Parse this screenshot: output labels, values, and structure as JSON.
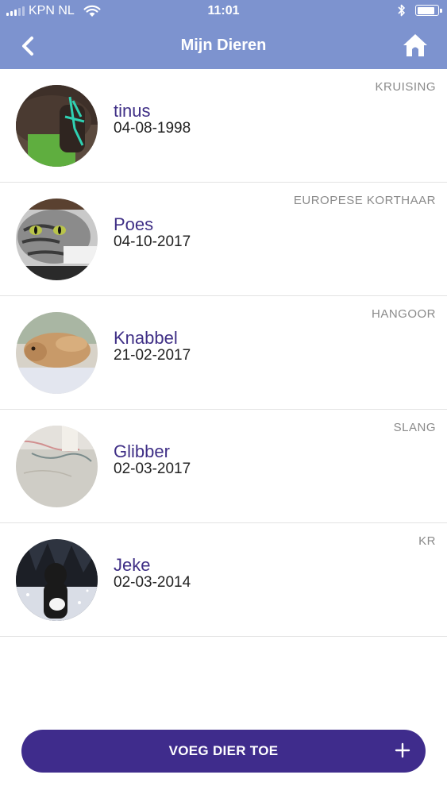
{
  "status_bar": {
    "carrier": "KPN NL",
    "time": "11:01"
  },
  "header": {
    "title": "Mijn Dieren"
  },
  "pets": [
    {
      "name": "tinus",
      "date": "04-08-1998",
      "breed": "KRUISING"
    },
    {
      "name": "Poes",
      "date": "04-10-2017",
      "breed": "EUROPESE KORTHAAR"
    },
    {
      "name": "Knabbel",
      "date": "21-02-2017",
      "breed": "HANGOOR"
    },
    {
      "name": "Glibber",
      "date": "02-03-2017",
      "breed": "SLANG"
    },
    {
      "name": "Jeke",
      "date": "02-03-2014",
      "breed": "KR"
    }
  ],
  "add_button": {
    "label": "VOEG DIER TOE"
  },
  "colors": {
    "header": "#7d93cf",
    "accent": "#3f2c8c",
    "name_text": "#3f2f86"
  }
}
